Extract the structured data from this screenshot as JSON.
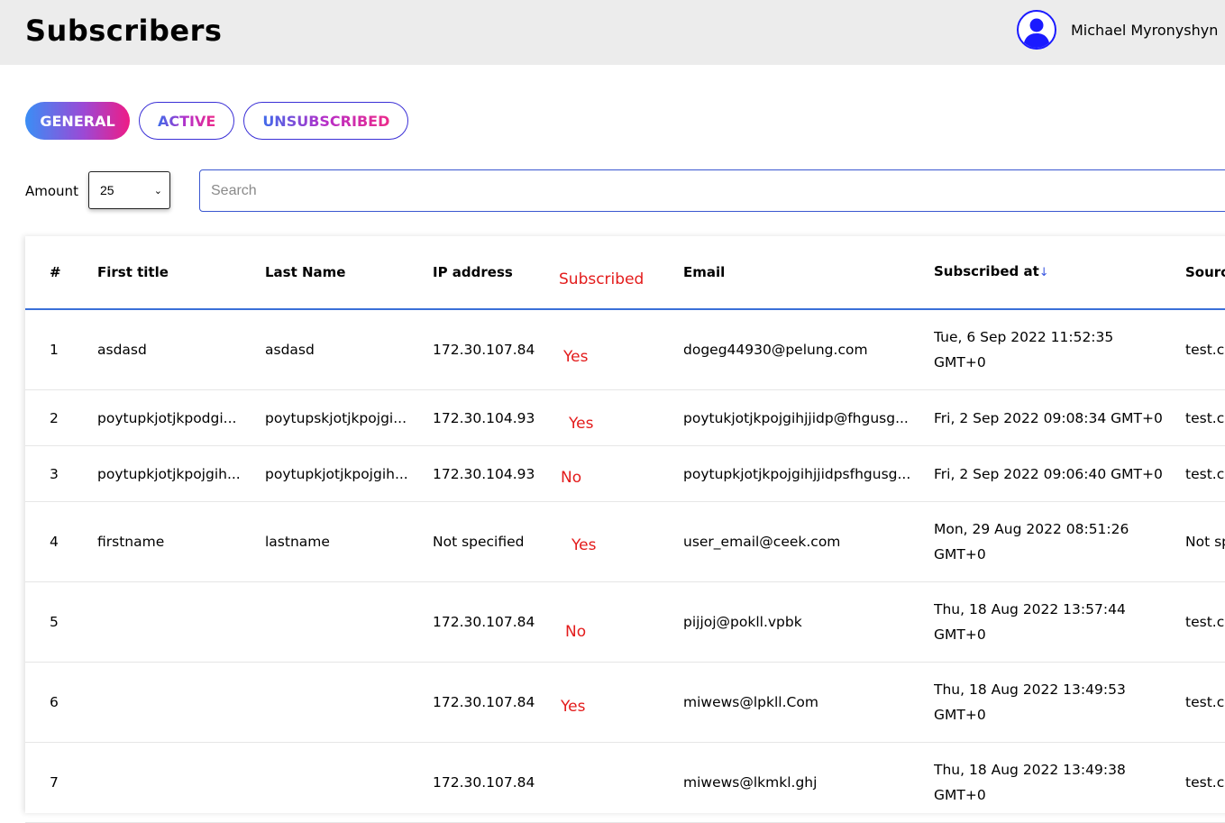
{
  "header": {
    "title": "Subscribers",
    "user_name": "Michael Myronyshyn",
    "avatar_icon": "user-avatar-icon",
    "accent_color": "#1a1aff"
  },
  "tabs": [
    {
      "label": "GENERAL",
      "active": true
    },
    {
      "label": "ACTIVE",
      "active": false
    },
    {
      "label": "UNSUBSCRIBED",
      "active": false
    }
  ],
  "filters": {
    "amount_label": "Amount",
    "amount_value": "25",
    "search_placeholder": "Search",
    "search_value": ""
  },
  "table": {
    "columns": {
      "num": "#",
      "first": "First title",
      "last": "Last Name",
      "ip": "IP address",
      "subscribed": "Subscribed",
      "email": "Email",
      "subscribed_at": "Subscribed at",
      "sort_indicator": "↓",
      "source": "Source"
    },
    "rows": [
      {
        "num": "1",
        "first": "asdasd",
        "last": "asdasd",
        "ip": "172.30.107.84",
        "subscribed": "Yes",
        "email": "dogeg44930@pelung.com",
        "date": "Tue, 6 Sep 2022 11:52:35 GMT+0",
        "source": "test.com"
      },
      {
        "num": "2",
        "first": "poytupkjotjkpodgi...",
        "last": "poytupskjotjkpojgi...",
        "ip": "172.30.104.93",
        "subscribed": "Yes",
        "email": "poytukjotjkpojgihjjidp@fhgusg...",
        "date": "Fri, 2 Sep 2022 09:08:34 GMT+0",
        "source": "test.com"
      },
      {
        "num": "3",
        "first": "poytupkjotjkpojgih...",
        "last": "poytupkjotjkpojgih...",
        "ip": "172.30.104.93",
        "subscribed": "No",
        "email": "poytupkjotjkpojgihjjidpsfhgusg...",
        "date": "Fri, 2 Sep 2022 09:06:40 GMT+0",
        "source": "test.com"
      },
      {
        "num": "4",
        "first": "firstname",
        "last": "lastname",
        "ip": "Not specified",
        "subscribed": "Yes",
        "email": "user_email@ceek.com",
        "date": "Mon, 29 Aug 2022 08:51:26 GMT+0",
        "source": "Not specified"
      },
      {
        "num": "5",
        "first": "",
        "last": "",
        "ip": "172.30.107.84",
        "subscribed": "No",
        "email": "pijjoj@pokll.vpbk",
        "date": "Thu, 18 Aug 2022 13:57:44 GMT+0",
        "source": "test.com"
      },
      {
        "num": "6",
        "first": "",
        "last": "",
        "ip": "172.30.107.84",
        "subscribed": "Yes",
        "email": "miwews@lpkll.Com",
        "date": "Thu, 18 Aug 2022 13:49:53 GMT+0",
        "source": "test.com"
      },
      {
        "num": "7",
        "first": "",
        "last": "",
        "ip": "172.30.107.84",
        "subscribed": "",
        "email": "miwews@lkmkl.ghj",
        "date": "Thu, 18 Aug 2022 13:49:38 GMT+0",
        "source": "test.com"
      }
    ]
  }
}
